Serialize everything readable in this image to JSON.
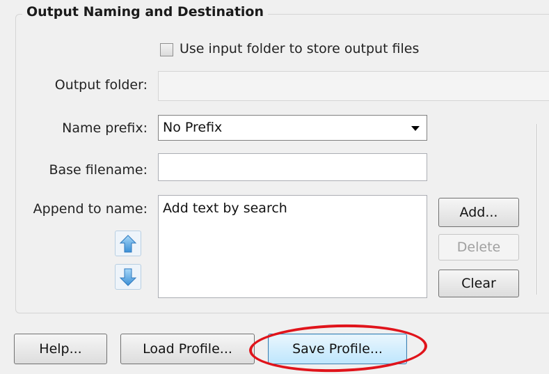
{
  "group": {
    "title": "Output Naming and Destination"
  },
  "use_input_folder": {
    "label": "Use input folder to store output files",
    "checked": false
  },
  "output_folder": {
    "label": "Output folder:",
    "value": ""
  },
  "name_prefix": {
    "label": "Name prefix:",
    "selected": "No Prefix"
  },
  "base_filename": {
    "label": "Base filename:",
    "value": ""
  },
  "append_to_name": {
    "label": "Append to name:",
    "items": [
      "Add text by search"
    ],
    "buttons": {
      "add": "Add...",
      "delete": "Delete",
      "clear": "Clear"
    }
  },
  "footer": {
    "help": "Help...",
    "load_profile": "Load Profile...",
    "save_profile": "Save Profile..."
  },
  "annotation": {
    "highlight_color": "#e0141b"
  }
}
